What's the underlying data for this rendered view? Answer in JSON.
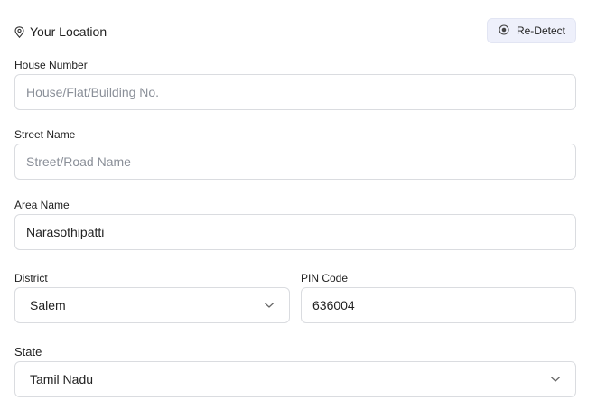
{
  "header": {
    "location_title": "Your Location",
    "redetect_label": "Re-Detect"
  },
  "house": {
    "label": "House Number",
    "value": "",
    "placeholder": "House/Flat/Building No."
  },
  "street": {
    "label": "Street Name",
    "value": "",
    "placeholder": "Street/Road Name"
  },
  "area": {
    "label": "Area Name",
    "value": "Narasothipatti",
    "placeholder": ""
  },
  "district": {
    "label": "District",
    "selected": "Salem"
  },
  "pin": {
    "label": "PIN Code",
    "value": "636004",
    "placeholder": ""
  },
  "state": {
    "label": "State",
    "selected": "Tamil Nadu"
  },
  "icons": {
    "location": "map-pin-icon",
    "redetect": "target-icon",
    "dropdown": "chevron-down-icon"
  }
}
